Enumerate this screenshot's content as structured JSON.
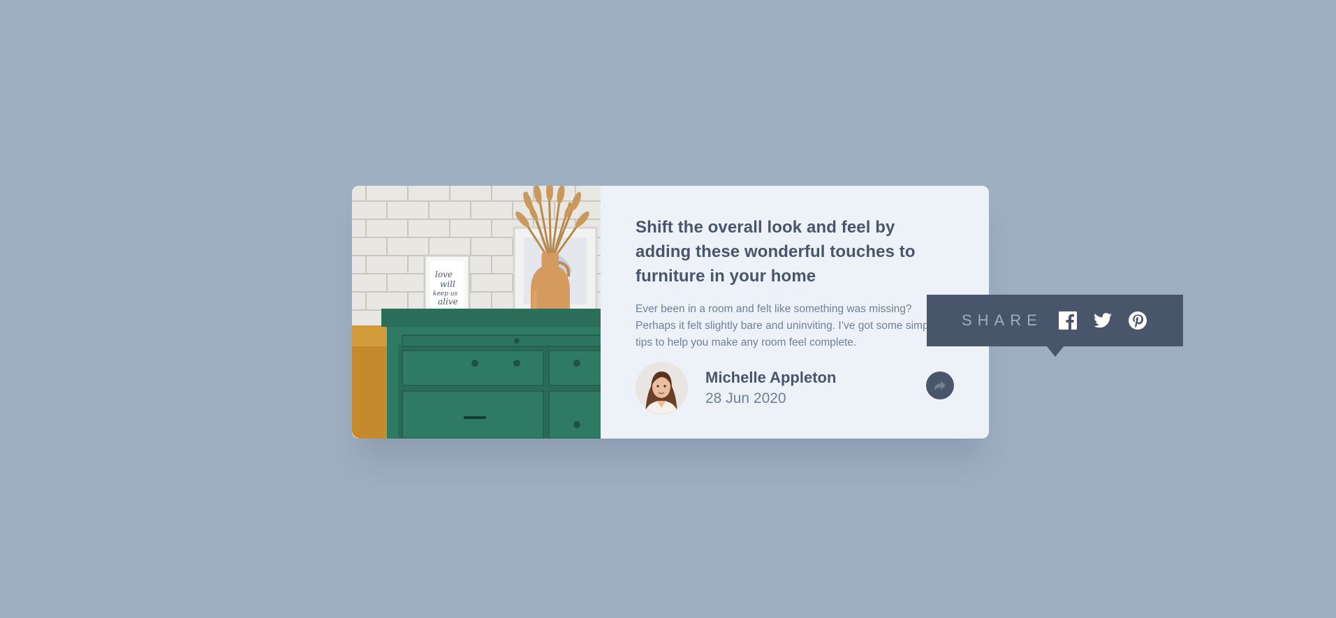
{
  "article": {
    "title": "Shift the overall look and feel by adding these wonderful touches to furniture in your home",
    "description": "Ever been in a room and felt like something was missing? Perhaps it felt slightly bare and uninviting. I’ve got some simple tips to help you make any room feel complete.",
    "image_icon": "drawers-photo",
    "frame_text": [
      "love",
      "will",
      "keep us",
      "alive"
    ]
  },
  "author": {
    "name": "Michelle Appleton",
    "date": "28 Jun 2020",
    "avatar_icon": "avatar-photo"
  },
  "share": {
    "label": "SHARE",
    "button_icon": "share-arrow-icon",
    "networks": [
      {
        "name": "facebook",
        "icon": "facebook-icon"
      },
      {
        "name": "twitter",
        "icon": "twitter-icon"
      },
      {
        "name": "pinterest",
        "icon": "pinterest-icon"
      }
    ]
  },
  "colors": {
    "background": "#9eafc2",
    "card": "#ecf2f8",
    "dark_blue": "#48556a",
    "grayish_blue": "#6e8098",
    "light_grayish_blue": "#9eafc2"
  }
}
